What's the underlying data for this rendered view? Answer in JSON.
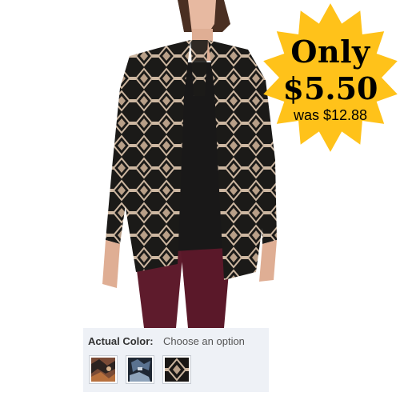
{
  "promo": {
    "line1": "Only",
    "price": "$5.50",
    "was": "was $12.88",
    "burst_color": "#ffc21a"
  },
  "product": {
    "image_icon": "cardigan-model-photo"
  },
  "color_selector": {
    "label": "Actual Color:",
    "value": "Choose an option",
    "swatches": [
      {
        "name": "multicolor-print",
        "color": "#7a4b36"
      },
      {
        "name": "blue-print",
        "color": "#2d3a4d"
      },
      {
        "name": "black-tan-print",
        "color": "#1a1715"
      }
    ]
  }
}
